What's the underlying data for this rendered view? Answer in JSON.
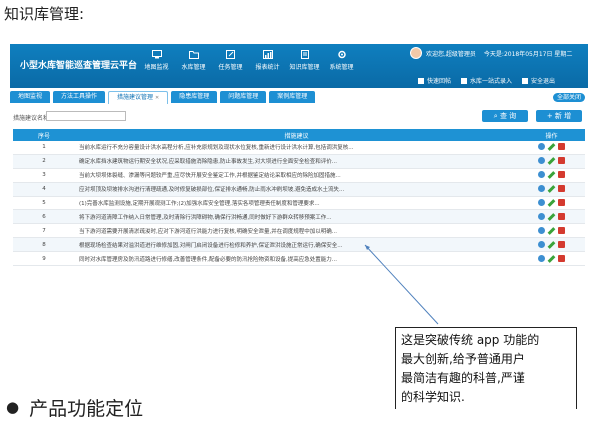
{
  "doc": {
    "heading": "知识库管理:",
    "bottom_heading": "产品功能定位"
  },
  "app": {
    "brand": "小型水库智能巡查管理云平台",
    "nav": [
      {
        "label": "地图监视",
        "icon": "monitor-icon"
      },
      {
        "label": "水库管理",
        "icon": "folder-icon"
      },
      {
        "label": "任务管理",
        "icon": "edit-icon"
      },
      {
        "label": "报表统计",
        "icon": "chart-icon"
      },
      {
        "label": "知识库管理",
        "icon": "book-icon"
      },
      {
        "label": "系统管理",
        "icon": "gear-icon"
      }
    ],
    "user": {
      "greeting": "欢迎您,超级管理员",
      "date": "今天是:2018年05月17日 星期二"
    },
    "quick_links": [
      "快速回帖",
      "水库一站式录入",
      "安全退出"
    ],
    "tabs": [
      {
        "label": "地图监视",
        "active": false
      },
      {
        "label": "方法工具操作",
        "active": false
      },
      {
        "label": "措施建议管理",
        "active": true
      },
      {
        "label": "隐患库管理",
        "active": false
      },
      {
        "label": "问题库管理",
        "active": false
      },
      {
        "label": "案例库管理",
        "active": false
      }
    ],
    "tab_extra": "全部关闭",
    "search": {
      "label": "措施建议名称:",
      "value": "",
      "query_button": "查 询",
      "new_button": "新 增"
    },
    "table": {
      "headers": [
        "序号",
        "措施建议",
        "操作"
      ],
      "rows": [
        {
          "no": "1",
          "text": "当前水库运行不充分容量设计洪水高程分析,应补充原规划及现状水位复核,重新进行设计洪水计算,包括调洪复核..."
        },
        {
          "no": "2",
          "text": "确定水库挡水建筑物运行期安全状况,应采取措施消除隐患,防止事故发生,对大坝进行全面安全检查和评价..."
        },
        {
          "no": "3",
          "text": "当前大坝坝体裂缝、渗漏等问题较严重,应尽快开展安全鉴定工作,并根据鉴定结论采取相应的除险加固措施..."
        },
        {
          "no": "4",
          "text": "应对坝顶及坝坡排水沟进行清理疏通,及时修复破损部位,保证排水通畅,防止雨水冲刷坝坡,避免造成水土流失..."
        },
        {
          "no": "5",
          "text": "(1)完善水库监测设施,定期开展观测工作;(2)加强水库安全管理,落实各项管理责任制度和管理要求..."
        },
        {
          "no": "6",
          "text": "将下游河道清障工作纳入日常管理,及时清除行洪障碍物,确保行洪畅通,同时做好下游群众转移预案工作..."
        },
        {
          "no": "7",
          "text": "当下游河道需要开展清淤疏浚时,应对下游河道行洪能力进行复核,明确安全泄量,并在调度规程中加以明确..."
        },
        {
          "no": "8",
          "text": "根据现场检查结果对溢洪道进行维修加固,对闸门启闭设备进行检修和养护,保证泄洪设施正常运行,确保安全..."
        },
        {
          "no": "9",
          "text": "同时对水库管理房及防汛道路进行修缮,改善管理条件,配备必要的防汛抢险物资和设备,提高应急处置能力..."
        }
      ]
    }
  },
  "annotation": {
    "lines": [
      "这是突破传统 app 功能的",
      "最大创新,给予普通用户",
      "最简洁有趣的科普,严谨",
      "的科学知识."
    ]
  }
}
